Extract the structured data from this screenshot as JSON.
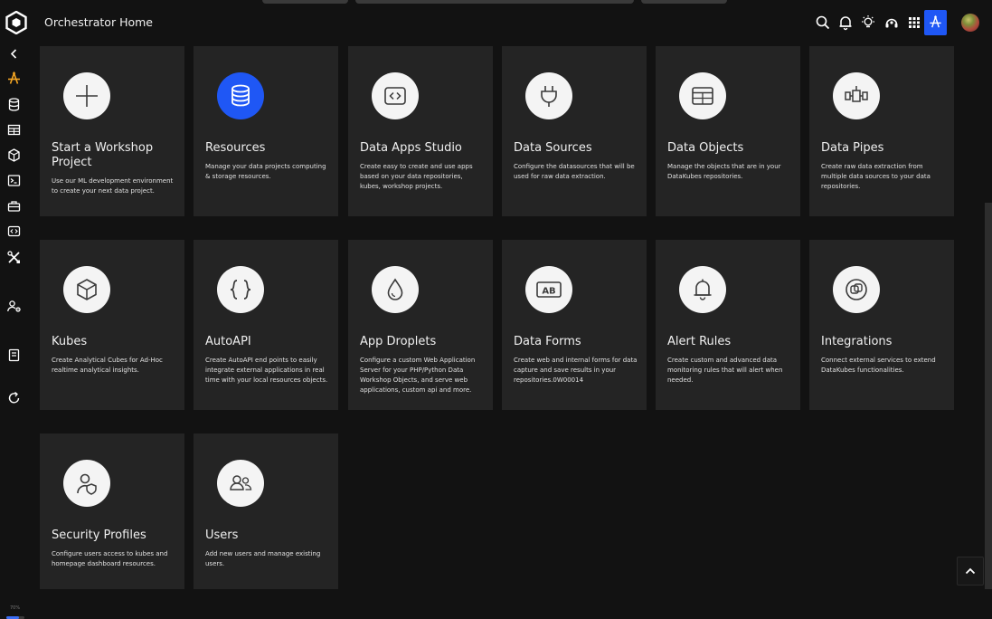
{
  "header": {
    "title": "Orchestrator Home",
    "toolbar_icons": [
      "search-icon",
      "bell-icon",
      "lightbulb-icon",
      "support-icon",
      "apps-grid-icon",
      "orchestrator-icon",
      "avatar"
    ],
    "active_icon": "orchestrator-icon"
  },
  "sidebar": {
    "items": [
      {
        "icon": "collapse-chevron-icon"
      },
      {
        "icon": "orchestrator-icon",
        "active": true
      },
      {
        "icon": "database-icon"
      },
      {
        "icon": "table-icon"
      },
      {
        "icon": "cube-icon"
      },
      {
        "icon": "terminal-icon"
      },
      {
        "icon": "toolbox-icon"
      },
      {
        "icon": "code-window-icon"
      },
      {
        "icon": "tools-icon"
      },
      {
        "icon": "user-settings-icon"
      },
      {
        "icon": "notebook-icon"
      },
      {
        "icon": "refresh-icon"
      }
    ],
    "zoom": {
      "label": "70%",
      "fill_fraction": 0.7
    }
  },
  "cards": [
    {
      "title": "Start a Workshop Project",
      "description": "Use our ML development environment to create your next data project.",
      "icon": "plus-icon"
    },
    {
      "title": "Resources",
      "description": "Manage your data projects computing & storage resources.",
      "icon": "database-icon",
      "highlight": true
    },
    {
      "title": "Data Apps Studio",
      "description": "Create easy to create and use apps based on your data repositories, kubes, workshop projects.",
      "icon": "code-window-icon"
    },
    {
      "title": "Data Sources",
      "description": "Configure the datasources that will be used for raw data extraction.",
      "icon": "plug-icon"
    },
    {
      "title": "Data Objects",
      "description": "Manage the objects that are in your DataKubes repositories.",
      "icon": "table-icon"
    },
    {
      "title": "Data Pipes",
      "description": "Create raw data extraction from multiple data sources to your data repositories.",
      "icon": "pipes-icon"
    },
    {
      "title": "Kubes",
      "description": "Create Analytical Cubes for Ad-Hoc realtime analytical insights.",
      "icon": "cube-icon"
    },
    {
      "title": "AutoAPI",
      "description": "Create AutoAPI end points to easily integrate external applications in real time with your local resources objects.",
      "icon": "braces-icon"
    },
    {
      "title": "App Droplets",
      "description": "Configure a custom Web Application Server for your PHP/Python Data Workshop Objects, and serve web applications, custom api and more.",
      "icon": "droplet-icon"
    },
    {
      "title": "Data Forms",
      "description": "Create web and internal forms for data capture and save results in your repositories.0W00014",
      "icon": "form-ab-icon"
    },
    {
      "title": "Alert Rules",
      "description": "Create custom and advanced data monitoring rules that will alert when needed.",
      "icon": "bell-icon"
    },
    {
      "title": "Integrations",
      "description": "Connect external services to extend DataKubes functionalities.",
      "icon": "integrations-icon"
    },
    {
      "title": "Security Profiles",
      "description": "Configure users access to kubes and homepage dashboard resources.",
      "icon": "user-shield-icon"
    },
    {
      "title": "Users",
      "description": "Add new users and manage existing users.",
      "icon": "users-icon"
    }
  ],
  "colors": {
    "accent": "#1f57f5",
    "sidebar_active": "#f5a623",
    "card_bg": "#242424",
    "page_bg": "#121212"
  }
}
